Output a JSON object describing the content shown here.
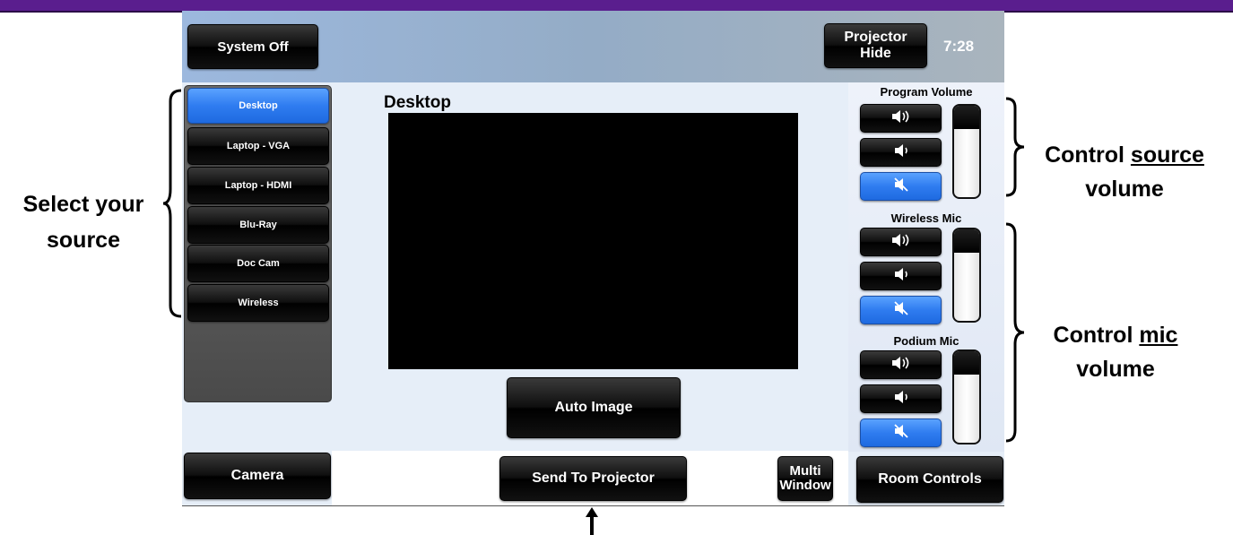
{
  "header": {
    "system_off": "System Off",
    "projector_hide": "Projector Hide",
    "clock": "7:28"
  },
  "sources": [
    {
      "label": "Desktop",
      "selected": true
    },
    {
      "label": "Laptop - VGA",
      "selected": false
    },
    {
      "label": "Laptop - HDMI",
      "selected": false
    },
    {
      "label": "Blu-Ray",
      "selected": false
    },
    {
      "label": "Doc Cam",
      "selected": false
    },
    {
      "label": "Wireless",
      "selected": false
    }
  ],
  "preview": {
    "title": "Desktop",
    "auto_image": "Auto Image"
  },
  "volume": {
    "program": "Program Volume",
    "wireless_mic": "Wireless Mic",
    "podium_mic": "Podium Mic"
  },
  "bottom": {
    "camera": "Camera",
    "send_to_projector": "Send To Projector",
    "multi_window": "Multi Window",
    "room_controls": "Room Controls"
  },
  "annotations": {
    "select_source": "Select your source",
    "control_source_prefix": "Control",
    "control_source_emph": "source",
    "control_source_suffix": "volume",
    "control_mic_prefix": "Control",
    "control_mic_emph": "mic",
    "control_mic_suffix": "volume"
  },
  "colors": {
    "accent_blue": "#2f7cf0",
    "top_bar_purple": "#5a1e8e",
    "button_black": "#000000"
  },
  "icons": [
    "volume-up-icon",
    "volume-down-icon",
    "mute-icon"
  ]
}
